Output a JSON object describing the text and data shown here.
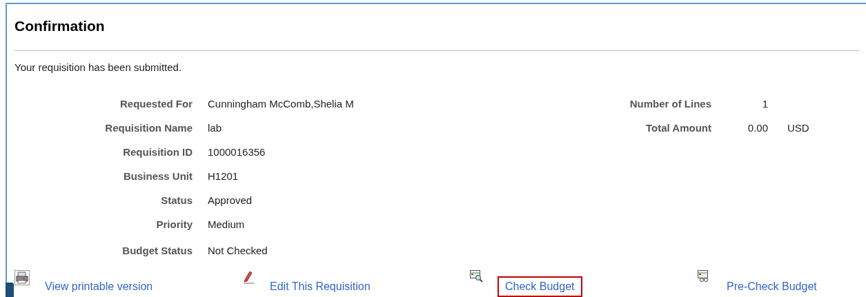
{
  "title": "Confirmation",
  "message": "Your requisition has been submitted.",
  "fields": [
    {
      "label": "Requested For",
      "value": "Cunningham McComb,Shelia M"
    },
    {
      "label": "Requisition Name",
      "value": "lab"
    },
    {
      "label": "Requisition ID",
      "value": "1000016356"
    },
    {
      "label": "Business Unit",
      "value": "H1201"
    },
    {
      "label": "Status",
      "value": "Approved"
    },
    {
      "label": "Priority",
      "value": "Medium"
    },
    {
      "label": "Budget Status",
      "value": "Not Checked"
    }
  ],
  "summary": [
    {
      "label": "Number of Lines",
      "value": "1"
    },
    {
      "label": "Total Amount",
      "value": "0.00",
      "currency": "USD"
    }
  ],
  "actions": [
    {
      "kind": "print",
      "label": "View printable version",
      "highlighted": false
    },
    {
      "kind": "edit",
      "label": "Edit This Requisition",
      "highlighted": false
    },
    {
      "kind": "check",
      "label": "Check Budget",
      "highlighted": true
    },
    {
      "kind": "precheck",
      "label": "Pre-Check Budget",
      "highlighted": false
    }
  ]
}
